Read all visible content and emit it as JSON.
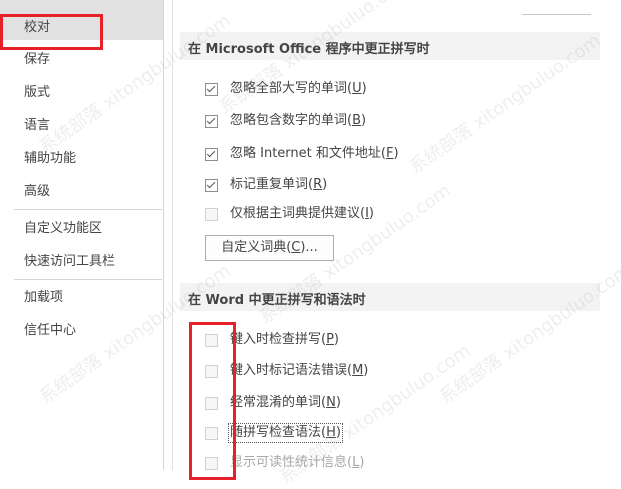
{
  "sidebar": {
    "items": [
      {
        "label": "校对"
      },
      {
        "label": "保存"
      },
      {
        "label": "版式"
      },
      {
        "label": "语言"
      },
      {
        "label": "辅助功能"
      },
      {
        "label": "高级"
      },
      {
        "label": "自定义功能区"
      },
      {
        "label": "快速访问工具栏"
      },
      {
        "label": "加载项"
      },
      {
        "label": "信任中心"
      }
    ]
  },
  "office_section": {
    "title": "在 Microsoft Office 程序中更正拼写时",
    "options": [
      {
        "text": "忽略全部大写的单词(",
        "key": "U",
        "end": ")",
        "checked": true
      },
      {
        "text": "忽略包含数字的单词(",
        "key": "B",
        "end": ")",
        "checked": true
      },
      {
        "text": "忽略 Internet 和文件地址(",
        "key": "F",
        "end": ")",
        "checked": true
      },
      {
        "text": "标记重复单词(",
        "key": "R",
        "end": ")",
        "checked": true
      },
      {
        "text": "仅根据主词典提供建议(",
        "key": "I",
        "end": ")",
        "checked": false
      }
    ],
    "dict_button": {
      "text": "自定义词典(",
      "key": "C",
      "end": ")..."
    }
  },
  "word_section": {
    "title": "在 Word 中更正拼写和语法时",
    "options": [
      {
        "text": "键入时检查拼写(",
        "key": "P",
        "end": ")",
        "checked": false
      },
      {
        "text": "键入时标记语法错误(",
        "key": "M",
        "end": ")",
        "checked": false
      },
      {
        "text": "经常混淆的单词(",
        "key": "N",
        "end": ")",
        "checked": false
      },
      {
        "text": "随拼写检查语法(",
        "key": "H",
        "end": ")",
        "checked": false
      },
      {
        "text": "显示可读性统计信息(",
        "key": "L",
        "end": ")",
        "checked": false
      }
    ]
  },
  "watermark": {
    "text": "系统部落 xitongbuluo.com"
  },
  "colors": {
    "annotation_red": "#e8202a",
    "section_bg": "#f3f3f3"
  }
}
